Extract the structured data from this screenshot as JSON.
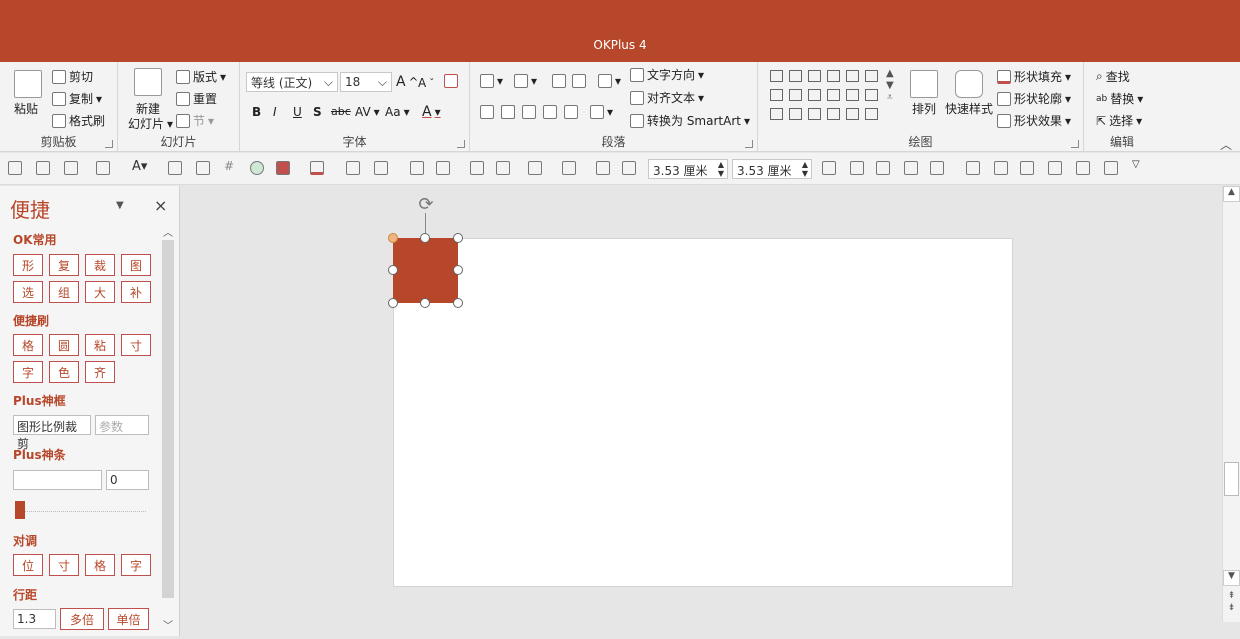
{
  "app": {
    "title": "OKPlus 4"
  },
  "ribbon": {
    "clipboard": {
      "label": "剪贴板",
      "paste": "粘贴",
      "cut": "剪切",
      "copy": "复制",
      "format_painter": "格式刷"
    },
    "slides": {
      "label": "幻灯片",
      "new_slide": "新建",
      "new_slide2": "幻灯片",
      "layout": "版式",
      "reset": "重置",
      "section": "节"
    },
    "font": {
      "label": "字体",
      "font_name": "等线 (正文)",
      "font_size": "18",
      "bold": "B",
      "italic": "I",
      "underline": "U",
      "shadow": "S",
      "strike": "abc",
      "spacing": "AV",
      "case": "Aa",
      "color": "A"
    },
    "paragraph": {
      "label": "段落",
      "text_direction": "文字方向",
      "align_text": "对齐文本",
      "smartart": "转换为 SmartArt"
    },
    "drawing": {
      "label": "绘图",
      "arrange": "排列",
      "quick_styles": "快速样式",
      "shape_fill": "形状填充",
      "shape_outline": "形状轮廓",
      "shape_effects": "形状效果"
    },
    "editing": {
      "label": "编辑",
      "find": "查找",
      "replace": "替换",
      "select": "选择"
    }
  },
  "toolbar2": {
    "width": "3.53 厘米",
    "height": "3.53 厘米"
  },
  "panel": {
    "title": "便捷",
    "ok_common": {
      "label": "OK常用",
      "row1": [
        "形",
        "复",
        "裁",
        "图"
      ],
      "row2": [
        "选",
        "组",
        "大",
        "补"
      ]
    },
    "brush": {
      "label": "便捷刷",
      "row1": [
        "格",
        "圆",
        "粘",
        "寸"
      ],
      "row2": [
        "字",
        "色",
        "齐"
      ]
    },
    "plus_frame": {
      "label": "Plus神框",
      "value": "图形比例裁剪",
      "param_placeholder": "参数"
    },
    "plus_bar": {
      "label": "Plus神条",
      "value": "",
      "num": "0"
    },
    "align": {
      "label": "对调",
      "row": [
        "位",
        "寸",
        "格",
        "字"
      ]
    },
    "line_spacing": {
      "label": "行距",
      "value": "1.3",
      "multi": "多倍",
      "single": "单倍"
    }
  },
  "colors": {
    "accent": "#b7472a"
  }
}
